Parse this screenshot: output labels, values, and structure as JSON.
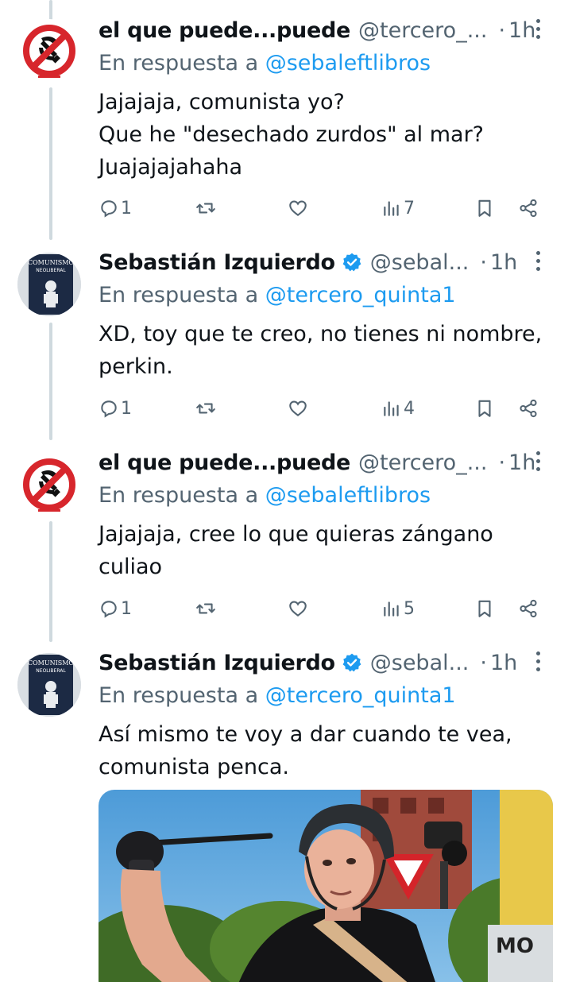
{
  "tweets": [
    {
      "name": "el que puede...puede",
      "handle": "@tercero_...",
      "dot": "·",
      "time": "1h",
      "verified": false,
      "reply_prefix": "En respuesta a",
      "reply_to": "@sebaleftlibros",
      "lines": [
        "Jajajaja, comunista yo?",
        "Que he \"desechado zurdos\" al mar?",
        "Juajajajahaha"
      ],
      "replies": "1",
      "views": "7"
    },
    {
      "name": "Sebastián Izquierdo",
      "handle": "@sebal...",
      "dot": "·",
      "time": "1h",
      "verified": true,
      "reply_prefix": "En respuesta a",
      "reply_to": "@tercero_quinta1",
      "lines": [
        "XD, toy que te creo, no tienes ni nombre,",
        "perkin."
      ],
      "replies": "1",
      "views": "4"
    },
    {
      "name": "el que puede...puede",
      "handle": "@tercero_...",
      "dot": "·",
      "time": "1h",
      "verified": false,
      "reply_prefix": "En respuesta a",
      "reply_to": "@sebaleftlibros",
      "lines": [
        "Jajajaja, cree lo que quieras zángano",
        "culiao"
      ],
      "replies": "1",
      "views": "5"
    },
    {
      "name": "Sebastián Izquierdo",
      "handle": "@sebal...",
      "dot": "·",
      "time": "1h",
      "verified": true,
      "reply_prefix": "En respuesta a",
      "reply_to": "@tercero_quinta1",
      "lines": [
        "Así mismo te voy a dar cuando te vea,",
        "comunista penca."
      ]
    }
  ],
  "avatar_text": {
    "book_title": "EL COMUNISMO NEOLIBERAL"
  },
  "icons": [
    "reply-icon",
    "retweet-icon",
    "like-icon",
    "views-icon",
    "bookmark-icon",
    "share-icon",
    "verified-badge-icon",
    "more-icon"
  ],
  "colors": {
    "link": "#1d9bf0",
    "secondary": "#536471",
    "verified": "#1d9bf0",
    "thread_line": "#cfd9de"
  }
}
